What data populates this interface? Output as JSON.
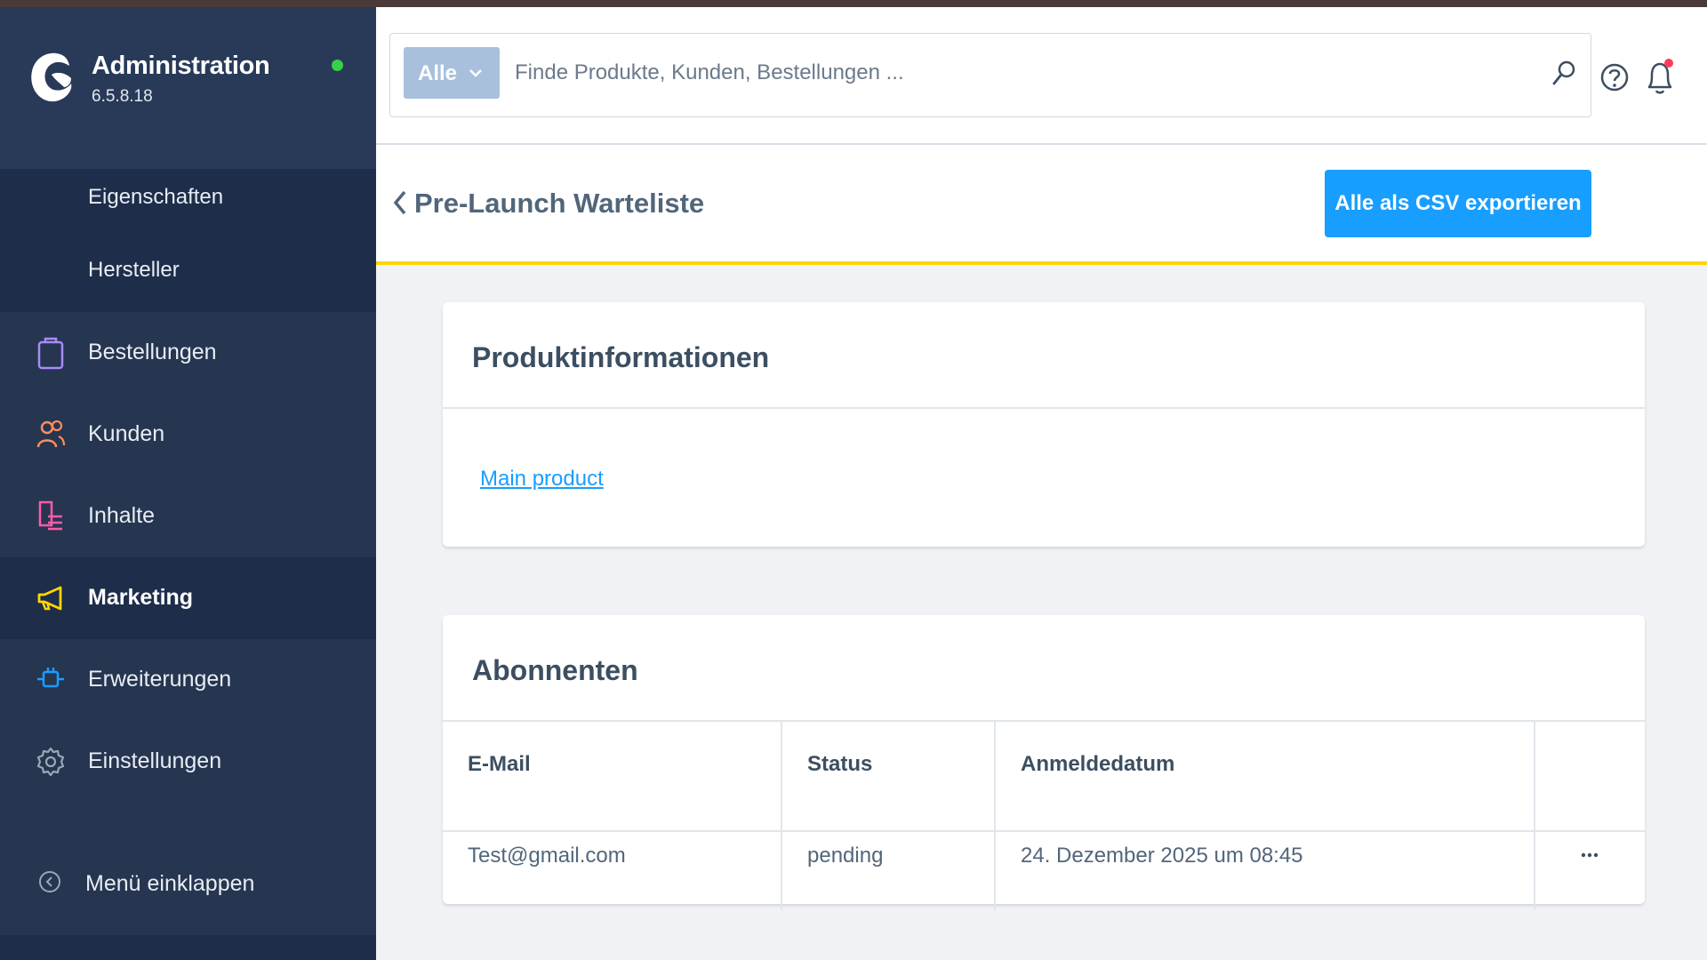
{
  "app": {
    "title": "Administration",
    "version": "6.5.8.18",
    "status_color": "#37d046"
  },
  "sidebar": {
    "subitems": [
      {
        "label": "Eigenschaften"
      },
      {
        "label": "Hersteller"
      }
    ],
    "items": [
      {
        "label": "Bestellungen",
        "icon": "shopping-bag-icon",
        "color": "#a78bfa"
      },
      {
        "label": "Kunden",
        "icon": "users-icon",
        "color": "#ff8d5c"
      },
      {
        "label": "Inhalte",
        "icon": "content-icon",
        "color": "#ff5ba8"
      },
      {
        "label": "Marketing",
        "icon": "megaphone-icon",
        "color": "#ffd700",
        "active": true
      },
      {
        "label": "Erweiterungen",
        "icon": "plug-icon",
        "color": "#189eff"
      },
      {
        "label": "Einstellungen",
        "icon": "gear-icon",
        "color": "#9aa8b5"
      }
    ],
    "collapse_label": "Menü einklappen"
  },
  "search": {
    "scope_label": "Alle",
    "placeholder": "Finde Produkte, Kunden, Bestellungen ..."
  },
  "page": {
    "title": "Pre-Launch Warteliste",
    "export_label": "Alle als CSV exportieren"
  },
  "product_card": {
    "title": "Produktinformationen",
    "link": "Main product"
  },
  "subscribers": {
    "title": "Abonnenten",
    "columns": [
      "E-Mail",
      "Status",
      "Anmeldedatum"
    ],
    "rows": [
      {
        "email": "Test@gmail.com",
        "status": "pending",
        "date": "24. Dezember 2025 um 08:45"
      }
    ]
  },
  "colors": {
    "sidebar_bg": "#263550",
    "accent": "#189eff",
    "highlight": "#ffd500"
  }
}
